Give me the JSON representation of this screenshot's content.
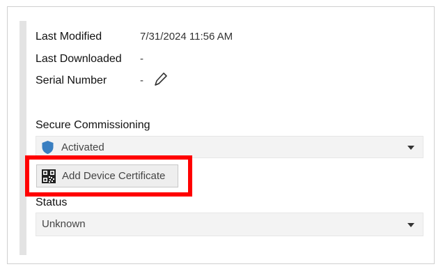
{
  "properties": {
    "last_modified": {
      "label": "Last Modified",
      "value": "7/31/2024 11:56 AM"
    },
    "last_downloaded": {
      "label": "Last Downloaded",
      "value": "-"
    },
    "serial_number": {
      "label": "Serial Number",
      "value": "-"
    }
  },
  "secure_commissioning": {
    "label": "Secure Commissioning",
    "selected": "Activated",
    "icon": "shield-icon"
  },
  "add_device_certificate": {
    "label": "Add Device Certificate",
    "icon": "qr-code-icon"
  },
  "status": {
    "label": "Status",
    "selected": "Unknown"
  },
  "colors": {
    "highlight": "#ff0000",
    "shield": "#3a7fc1"
  }
}
